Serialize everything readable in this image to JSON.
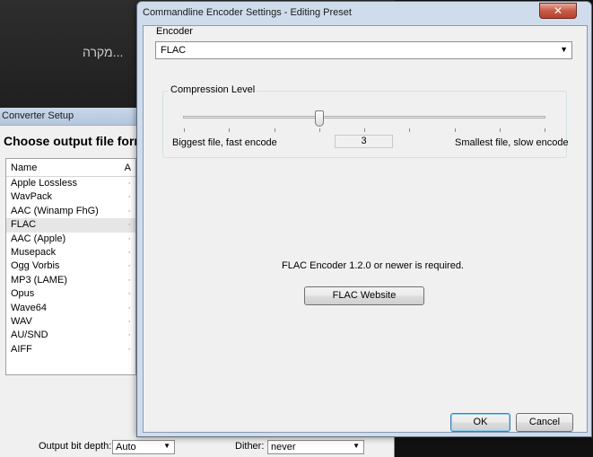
{
  "background": {
    "hebrew_text": "מקרה..."
  },
  "converter": {
    "title": "Converter Setup",
    "heading": "Choose output file form",
    "list_header": {
      "name": "Name",
      "col2": "A"
    },
    "formats": [
      "Apple Lossless",
      "WavPack",
      "AAC (Winamp FhG)",
      "FLAC",
      "AAC (Apple)",
      "Musepack",
      "Ogg Vorbis",
      "MP3 (LAME)",
      "Opus",
      "Wave64",
      "WAV",
      "AU/SND",
      "AIFF"
    ],
    "selected_format": "FLAC",
    "bit_depth_label": "Output bit depth:",
    "bit_depth_value": "Auto",
    "dither_label": "Dither:",
    "dither_value": "never"
  },
  "dialog": {
    "title": "Commandline Encoder Settings - Editing Preset",
    "close_label": "✕",
    "encoder_label": "Encoder",
    "encoder_value": "FLAC",
    "compression": {
      "title": "Compression Level",
      "left_label": "Biggest file, fast encode",
      "right_label": "Smallest file, slow encode",
      "value": "3",
      "level_fraction": 0.375
    },
    "requirement_text": "FLAC Encoder 1.2.0 or newer is required.",
    "website_button": "FLAC Website",
    "ok_button": "OK",
    "cancel_button": "Cancel"
  }
}
